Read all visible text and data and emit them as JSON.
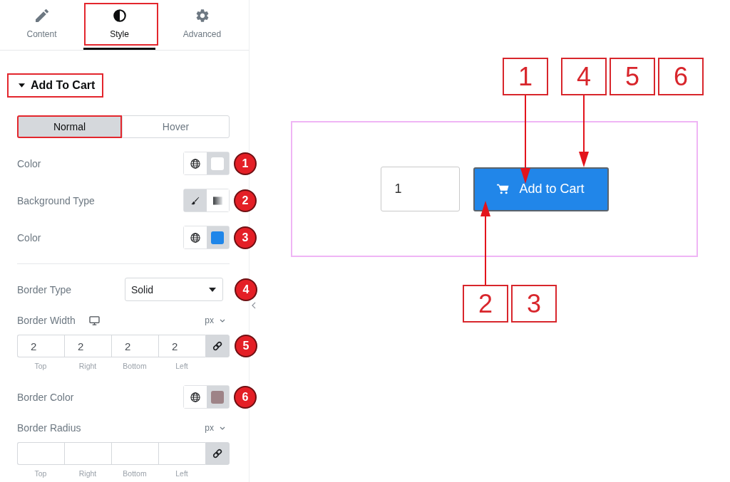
{
  "tabs": [
    {
      "kind": "pencil",
      "label": "Content",
      "selected": false,
      "highlighted": false
    },
    {
      "kind": "half-circle",
      "label": "Style",
      "selected": true,
      "highlighted": true
    },
    {
      "kind": "gear",
      "label": "Advanced",
      "selected": false,
      "highlighted": false
    }
  ],
  "section": {
    "title": "Add To Cart",
    "expanded": true,
    "highlighted": true
  },
  "state_tabs": [
    {
      "label": "Normal",
      "selected": true,
      "highlighted": true
    },
    {
      "label": "Hover",
      "selected": false,
      "highlighted": false
    }
  ],
  "controls": [
    {
      "kind": "color",
      "label": "Color",
      "color": "#ffffff",
      "marker": "1"
    },
    {
      "kind": "choice",
      "label": "Background Type",
      "options": [
        {
          "kind": "brush",
          "selected": true
        },
        {
          "kind": "gradient",
          "selected": false
        }
      ],
      "marker": "2"
    },
    {
      "kind": "color",
      "label": "Color",
      "color": "#1f86e9",
      "marker": "3"
    },
    {
      "kind": "divider"
    },
    {
      "kind": "select",
      "label": "Border Type",
      "value": "Solid",
      "marker": "4"
    },
    {
      "kind": "dimensions",
      "label": "Border Width",
      "responsive": true,
      "unit": "px",
      "values": [
        "2",
        "2",
        "2",
        "2"
      ],
      "sides": [
        "Top",
        "Right",
        "Bottom",
        "Left"
      ],
      "linked": true,
      "marker": "5"
    },
    {
      "kind": "color",
      "label": "Border Color",
      "color": "#9e8387",
      "marker": "6"
    },
    {
      "kind": "dimensions",
      "label": "Border Radius",
      "responsive": false,
      "unit": "px",
      "sides": [
        "Top",
        "Right",
        "Bottom",
        "Left"
      ],
      "linked": true
    }
  ],
  "preview": {
    "quantity": "1",
    "button_label": "Add to Cart"
  },
  "callouts": {
    "top": [
      {
        "label": "1",
        "arrow": true
      },
      {
        "label": "4",
        "arrow": true
      },
      {
        "label": "5",
        "arrow": false
      },
      {
        "label": "6",
        "arrow": false
      }
    ],
    "bottom": [
      {
        "label": "2",
        "arrow": true
      },
      {
        "label": "3",
        "arrow": false
      }
    ]
  }
}
